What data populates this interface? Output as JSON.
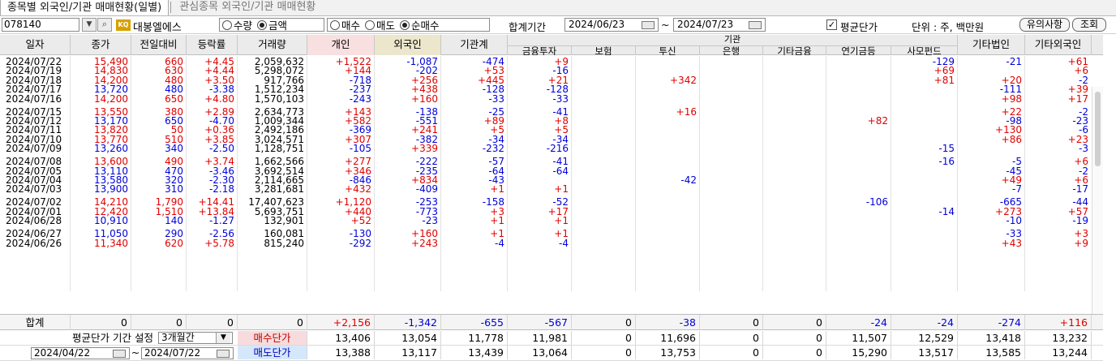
{
  "tabs": [
    "종목별 외국인/기관 매매현황(일별)",
    "관심종목 외국인/기관 매매현황"
  ],
  "toolbar": {
    "code": "078140",
    "stock_name": "대봉엘에스",
    "unit_radios": [
      {
        "label": "수량",
        "checked": false
      },
      {
        "label": "금액",
        "checked": true
      }
    ],
    "side_radios": [
      {
        "label": "매수",
        "checked": false
      },
      {
        "label": "매도",
        "checked": false
      },
      {
        "label": "순매수",
        "checked": true
      }
    ],
    "period_label": "합계기간",
    "date_from": "2024/06/23",
    "tilde": "~",
    "date_to": "2024/07/23",
    "avg_price_label": "평균단가",
    "avg_price_checked": true,
    "unit_text": "단위 : 주, 백만원",
    "notice_button": "유의사항",
    "query_button": "조회"
  },
  "headers": {
    "date": "일자",
    "close": "종가",
    "change": "전일대비",
    "rate": "등락률",
    "volume": "거래량",
    "individual": "개인",
    "foreign": "외국인",
    "institution": "기관계",
    "inst_group": "기관",
    "inst_sub": [
      "금융투자",
      "보험",
      "투신",
      "은행",
      "기타금융",
      "연기금등",
      "사모펀드"
    ],
    "other_corp": "기타법인",
    "other_foreign": "기타외국인"
  },
  "rows": [
    {
      "date": "2024/07/22",
      "close": "15,490",
      "chg": "660",
      "rate": "+4.45",
      "vol": "2,059,632",
      "ind": "+1,522",
      "frg": "-1,087",
      "inst": "-474",
      "s": [
        "+9",
        "",
        "",
        "",
        "",
        "",
        "-129"
      ],
      "corp": "-21",
      "ofr": "+61",
      "dir": "up"
    },
    {
      "date": "2024/07/19",
      "close": "14,830",
      "chg": "630",
      "rate": "+4.44",
      "vol": "5,298,072",
      "ind": "+144",
      "frg": "-202",
      "inst": "+53",
      "s": [
        "-16",
        "",
        "",
        "",
        "",
        "",
        "+69"
      ],
      "corp": "",
      "ofr": "+6",
      "dir": "up"
    },
    {
      "date": "2024/07/18",
      "close": "14,200",
      "chg": "480",
      "rate": "+3.50",
      "vol": "917,766",
      "ind": "-718",
      "frg": "+256",
      "inst": "+445",
      "s": [
        "+21",
        "",
        "+342",
        "",
        "",
        "",
        "+81"
      ],
      "corp": "+20",
      "ofr": "-2",
      "dir": "up"
    },
    {
      "date": "2024/07/17",
      "close": "13,720",
      "chg": "480",
      "rate": "-3.38",
      "vol": "1,512,234",
      "ind": "-237",
      "frg": "+438",
      "inst": "-128",
      "s": [
        "-128",
        "",
        "",
        "",
        "",
        "",
        ""
      ],
      "corp": "-111",
      "ofr": "+39",
      "dir": "down"
    },
    {
      "date": "2024/07/16",
      "close": "14,200",
      "chg": "650",
      "rate": "+4.80",
      "vol": "1,570,103",
      "ind": "-243",
      "frg": "+160",
      "inst": "-33",
      "s": [
        "-33",
        "",
        "",
        "",
        "",
        "",
        ""
      ],
      "corp": "+98",
      "ofr": "+17",
      "dir": "up"
    },
    {
      "date": "2024/07/15",
      "close": "13,550",
      "chg": "380",
      "rate": "+2.89",
      "vol": "2,634,773",
      "ind": "+143",
      "frg": "-138",
      "inst": "-25",
      "s": [
        "-41",
        "",
        "+16",
        "",
        "",
        "",
        ""
      ],
      "corp": "+22",
      "ofr": "-2",
      "dir": "up"
    },
    {
      "date": "2024/07/12",
      "close": "13,170",
      "chg": "650",
      "rate": "-4.70",
      "vol": "1,009,344",
      "ind": "+582",
      "frg": "-551",
      "inst": "+89",
      "s": [
        "+8",
        "",
        "",
        "",
        "",
        "+82",
        ""
      ],
      "corp": "-98",
      "ofr": "-23",
      "dir": "down"
    },
    {
      "date": "2024/07/11",
      "close": "13,820",
      "chg": "50",
      "rate": "+0.36",
      "vol": "2,492,186",
      "ind": "-369",
      "frg": "+241",
      "inst": "+5",
      "s": [
        "+5",
        "",
        "",
        "",
        "",
        "",
        ""
      ],
      "corp": "+130",
      "ofr": "-6",
      "dir": "up"
    },
    {
      "date": "2024/07/10",
      "close": "13,770",
      "chg": "510",
      "rate": "+3.85",
      "vol": "3,024,571",
      "ind": "+307",
      "frg": "-382",
      "inst": "-34",
      "s": [
        "-34",
        "",
        "",
        "",
        "",
        "",
        ""
      ],
      "corp": "+86",
      "ofr": "+23",
      "dir": "up"
    },
    {
      "date": "2024/07/09",
      "close": "13,260",
      "chg": "340",
      "rate": "-2.50",
      "vol": "1,128,751",
      "ind": "-105",
      "frg": "+339",
      "inst": "-232",
      "s": [
        "-216",
        "",
        "",
        "",
        "",
        "",
        "-15"
      ],
      "corp": "",
      "ofr": "-3",
      "dir": "down"
    },
    {
      "date": "2024/07/08",
      "close": "13,600",
      "chg": "490",
      "rate": "+3.74",
      "vol": "1,662,566",
      "ind": "+277",
      "frg": "-222",
      "inst": "-57",
      "s": [
        "-41",
        "",
        "",
        "",
        "",
        "",
        "-16"
      ],
      "corp": "-5",
      "ofr": "+6",
      "dir": "up"
    },
    {
      "date": "2024/07/05",
      "close": "13,110",
      "chg": "470",
      "rate": "-3.46",
      "vol": "3,692,514",
      "ind": "+346",
      "frg": "-235",
      "inst": "-64",
      "s": [
        "-64",
        "",
        "",
        "",
        "",
        "",
        ""
      ],
      "corp": "-45",
      "ofr": "-2",
      "dir": "down"
    },
    {
      "date": "2024/07/04",
      "close": "13,580",
      "chg": "320",
      "rate": "-2.30",
      "vol": "2,114,665",
      "ind": "-846",
      "frg": "+834",
      "inst": "-43",
      "s": [
        "",
        "",
        "-42",
        "",
        "",
        "",
        ""
      ],
      "corp": "+49",
      "ofr": "+6",
      "dir": "down"
    },
    {
      "date": "2024/07/03",
      "close": "13,900",
      "chg": "310",
      "rate": "-2.18",
      "vol": "3,281,681",
      "ind": "+432",
      "frg": "-409",
      "inst": "+1",
      "s": [
        "+1",
        "",
        "",
        "",
        "",
        "",
        ""
      ],
      "corp": "-7",
      "ofr": "-17",
      "dir": "down"
    },
    {
      "date": "2024/07/02",
      "close": "14,210",
      "chg": "1,790",
      "rate": "+14.41",
      "vol": "17,407,623",
      "ind": "+1,120",
      "frg": "-253",
      "inst": "-158",
      "s": [
        "-52",
        "",
        "",
        "",
        "",
        "-106",
        ""
      ],
      "corp": "-665",
      "ofr": "-44",
      "dir": "up"
    },
    {
      "date": "2024/07/01",
      "close": "12,420",
      "chg": "1,510",
      "rate": "+13.84",
      "vol": "5,693,751",
      "ind": "+440",
      "frg": "-773",
      "inst": "+3",
      "s": [
        "+17",
        "",
        "",
        "",
        "",
        "",
        "-14"
      ],
      "corp": "+273",
      "ofr": "+57",
      "dir": "up"
    },
    {
      "date": "2024/06/28",
      "close": "10,910",
      "chg": "140",
      "rate": "-1.27",
      "vol": "132,901",
      "ind": "+52",
      "frg": "-23",
      "inst": "+1",
      "s": [
        "+1",
        "",
        "",
        "",
        "",
        "",
        ""
      ],
      "corp": "-10",
      "ofr": "-19",
      "dir": "down"
    },
    {
      "date": "2024/06/27",
      "close": "11,050",
      "chg": "290",
      "rate": "-2.56",
      "vol": "160,081",
      "ind": "-130",
      "frg": "+160",
      "inst": "+1",
      "s": [
        "+1",
        "",
        "",
        "",
        "",
        "",
        ""
      ],
      "corp": "-33",
      "ofr": "+3",
      "dir": "down"
    },
    {
      "date": "2024/06/26",
      "close": "11,340",
      "chg": "620",
      "rate": "+5.78",
      "vol": "815,240",
      "ind": "-292",
      "frg": "+243",
      "inst": "-4",
      "s": [
        "-4",
        "",
        "",
        "",
        "",
        "",
        ""
      ],
      "corp": "+43",
      "ofr": "+9",
      "dir": "up"
    }
  ],
  "totals": {
    "label": "합계",
    "close": "0",
    "chg": "0",
    "rate": "0",
    "vol": "0",
    "ind": "+2,156",
    "frg": "-1,342",
    "inst": "-655",
    "s": [
      "-567",
      "0",
      "-38",
      "0",
      "0",
      "-24",
      "-24"
    ],
    "corp": "-274",
    "ofr": "+116"
  },
  "avg": {
    "period_label": "평균단가 기간 설정",
    "period_value": "3개월간",
    "from": "2024/04/22",
    "tilde": "~",
    "to": "2024/07/22",
    "buy_label": "매수단가",
    "sell_label": "매도단가",
    "buy": [
      "13,406",
      "13,054",
      "11,778",
      "11,981",
      "0",
      "11,696",
      "0",
      "0",
      "11,507",
      "12,529",
      "13,418",
      "13,232"
    ],
    "sell": [
      "13,388",
      "13,117",
      "13,439",
      "13,064",
      "0",
      "13,753",
      "0",
      "0",
      "15,290",
      "13,517",
      "13,585",
      "13,244"
    ]
  },
  "colors": {
    "up": "#e00000",
    "down": "#0000d8",
    "individual_header": "#f8dfe0",
    "foreign_header": "#ece6cc"
  }
}
